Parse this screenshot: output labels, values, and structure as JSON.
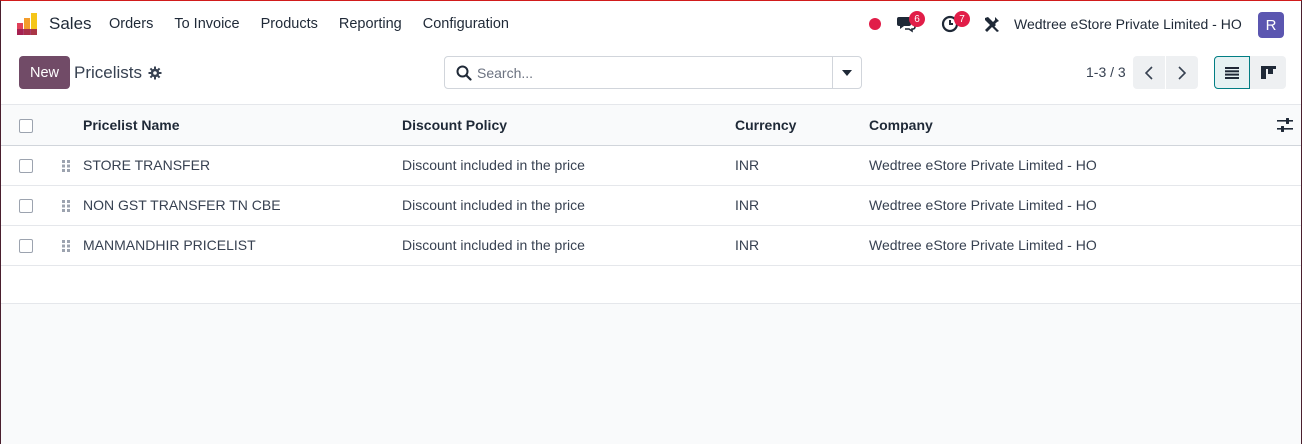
{
  "navbar": {
    "app_name": "Sales",
    "menu": [
      "Orders",
      "To Invoice",
      "Products",
      "Reporting",
      "Configuration"
    ],
    "chat_count": "6",
    "activity_count": "7",
    "company": "Wedtree eStore Private Limited - HO",
    "avatar_letter": "R"
  },
  "control": {
    "new_label": "New",
    "title": "Pricelists",
    "search_placeholder": "Search...",
    "pager": "1-3 / 3"
  },
  "table": {
    "headers": {
      "name": "Pricelist Name",
      "discount": "Discount Policy",
      "currency": "Currency",
      "company": "Company"
    },
    "rows": [
      {
        "name": "STORE TRANSFER",
        "discount": "Discount included in the price",
        "currency": "INR",
        "company": "Wedtree eStore Private Limited - HO"
      },
      {
        "name": "NON GST TRANSFER TN CBE",
        "discount": "Discount included in the price",
        "currency": "INR",
        "company": "Wedtree eStore Private Limited - HO"
      },
      {
        "name": "MANMANDHIR PRICELIST",
        "discount": "Discount included in the price",
        "currency": "INR",
        "company": "Wedtree eStore Private Limited - HO"
      }
    ]
  },
  "colors": {
    "brand": "#714b67",
    "badge": "#e11d48",
    "accent": "#017e84",
    "avatar": "#5b56b0"
  }
}
